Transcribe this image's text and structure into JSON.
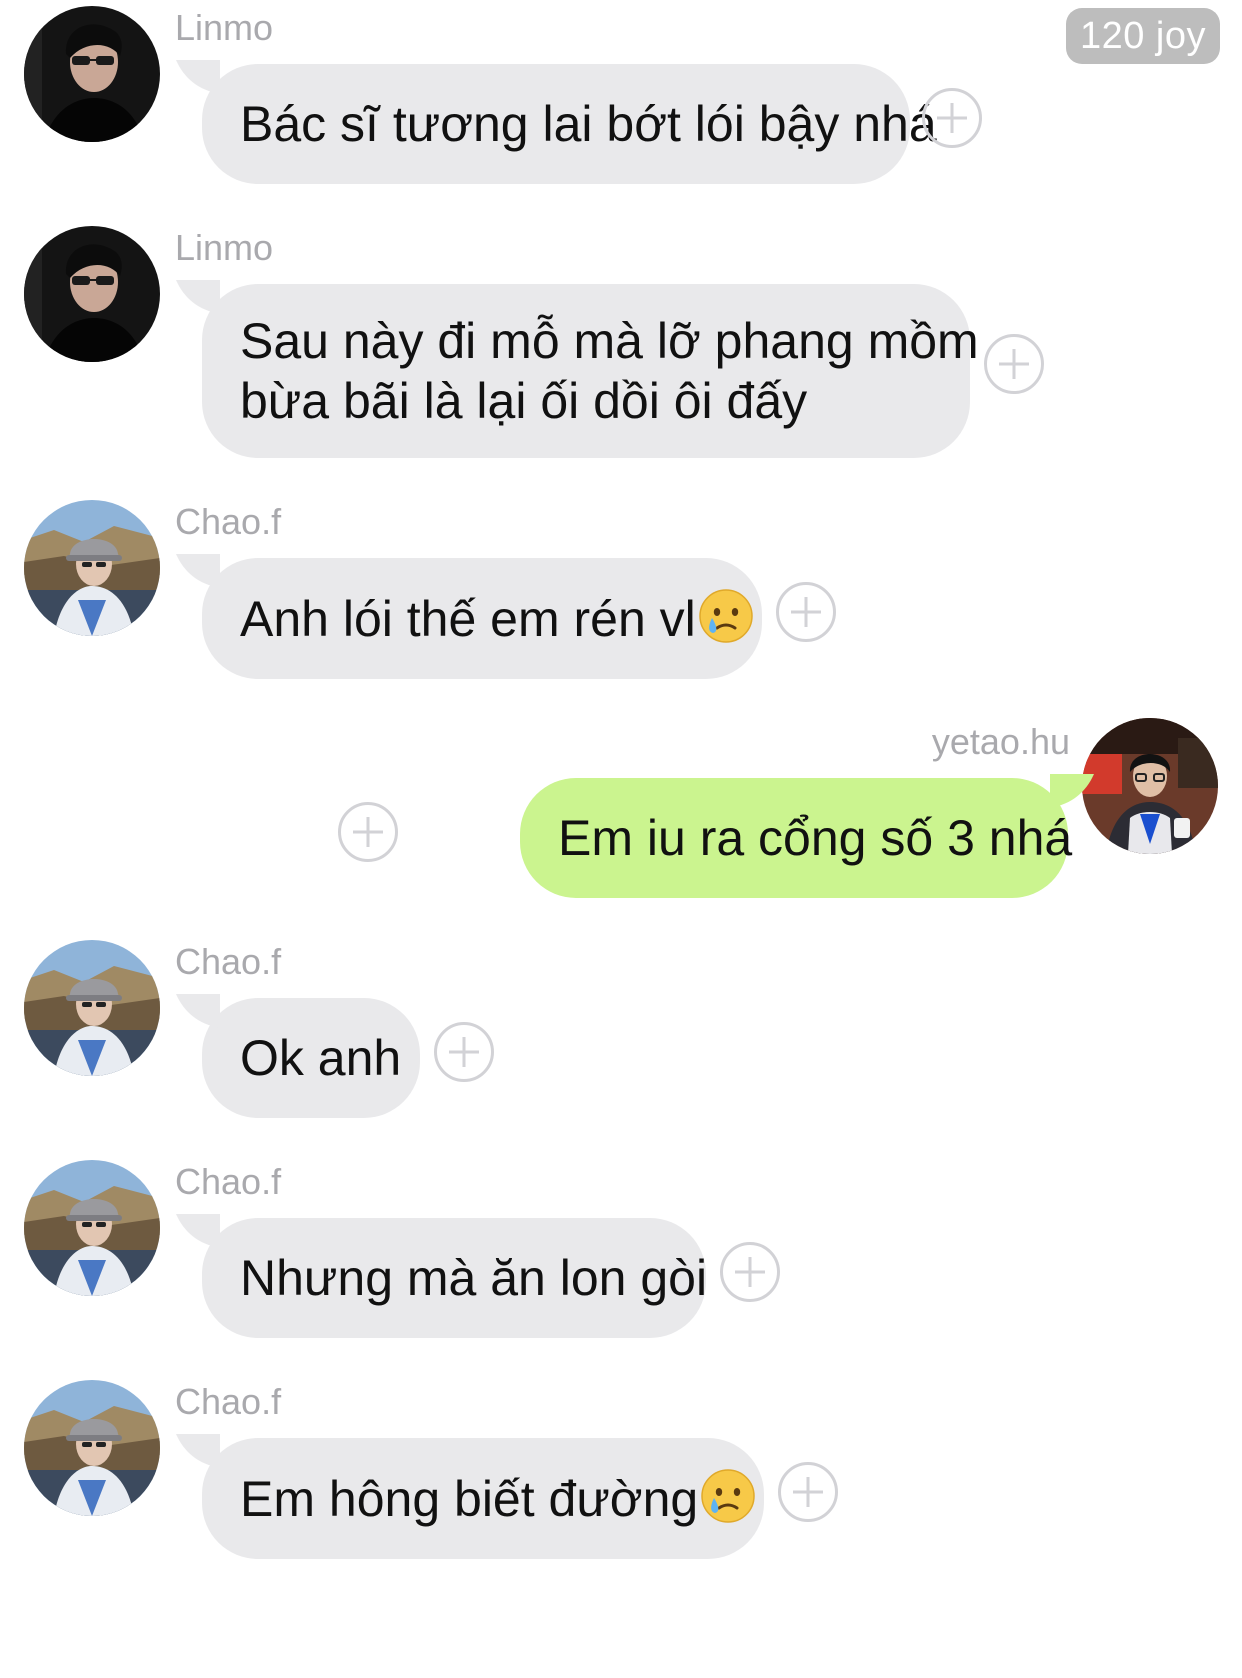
{
  "header": {
    "badge": "120 joy"
  },
  "messages": [
    {
      "sender": "Linmo",
      "text": "Bác sĩ tương lai bớt lói bậy nhá",
      "direction": "in",
      "avatar": "linmo-avatar"
    },
    {
      "sender": "Linmo",
      "text_lines": [
        "Sau này đi mỗ mà lỡ phang mồm",
        "bừa bãi là lại ối dồi ôi đấy"
      ],
      "direction": "in",
      "avatar": "linmo-avatar"
    },
    {
      "sender": "Chao.f",
      "text": "Anh lói thế em rén vl",
      "emoji": "crying-face",
      "direction": "in",
      "avatar": "chao-avatar"
    },
    {
      "sender": "yetao.hu",
      "text": "Em iu ra cổng số 3 nhá",
      "direction": "out",
      "avatar": "yetao-avatar"
    },
    {
      "sender": "Chao.f",
      "text": "Ok anh",
      "direction": "in",
      "avatar": "chao-avatar"
    },
    {
      "sender": "Chao.f",
      "text": "Nhưng mà ăn lon gòi",
      "direction": "in",
      "avatar": "chao-avatar"
    },
    {
      "sender": "Chao.f",
      "text": "Em hông biết đường",
      "emoji": "crying-face",
      "direction": "in",
      "avatar": "chao-avatar"
    }
  ],
  "colors": {
    "incoming_bubble": "#e9e9eb",
    "outgoing_bubble": "#cbf48f",
    "sender_name": "#a9a9ad",
    "badge": "#bdbdbd"
  }
}
